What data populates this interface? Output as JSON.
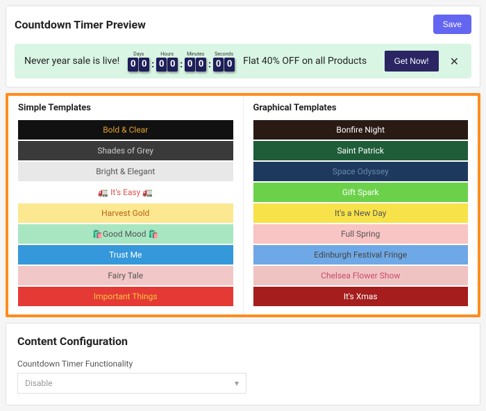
{
  "preview": {
    "title": "Countdown Timer Preview",
    "save_label": "Save",
    "banner_text_left": "Never year sale is live!",
    "banner_text_right": "Flat 40% OFF on all Products",
    "timer_labels": [
      "Days",
      "Hours",
      "Minutes",
      "Seconds"
    ],
    "timer_values": [
      "00",
      "00",
      "00",
      "00"
    ],
    "get_now_label": "Get Now!",
    "close_glyph": "✕"
  },
  "templates": {
    "simple_title": "Simple Templates",
    "graphical_title": "Graphical Templates",
    "simple": [
      {
        "label": "Bold & Clear",
        "bg": "#111111",
        "fg": "#e0a030"
      },
      {
        "label": "Shades of Grey",
        "bg": "#3a3a3a",
        "fg": "#cccccc"
      },
      {
        "label": "Bright & Elegant",
        "bg": "#e8e8e8",
        "fg": "#555555"
      },
      {
        "label": "🚛 It's Easy 🚛",
        "bg": "#ffffff",
        "fg": "#d9534f"
      },
      {
        "label": "Harvest Gold",
        "bg": "#fce890",
        "fg": "#b8621b"
      },
      {
        "label": "🛍️Good Mood 🛍️",
        "bg": "#a8e6c2",
        "fg": "#555555"
      },
      {
        "label": "Trust Me",
        "bg": "#3498db",
        "fg": "#ffffff"
      },
      {
        "label": "Fairy Tale",
        "bg": "#f2c7c7",
        "fg": "#555555"
      },
      {
        "label": "Important Things",
        "bg": "#e53935",
        "fg": "#f5c542"
      }
    ],
    "graphical": [
      {
        "label": "Bonfire Night",
        "bg": "#2a1a14",
        "fg": "#ffffff"
      },
      {
        "label": "Saint Patrick",
        "bg": "#1e5d38",
        "fg": "#ffffff"
      },
      {
        "label": "Space Odyssey",
        "bg": "#1d3a5e",
        "fg": "#6a88a8"
      },
      {
        "label": "Gift Spark",
        "bg": "#6cd14a",
        "fg": "#ffffff"
      },
      {
        "label": "It's a New Day",
        "bg": "#f7e24a",
        "fg": "#555555"
      },
      {
        "label": "Full Spring",
        "bg": "#f8c4c4",
        "fg": "#555555"
      },
      {
        "label": "Edinburgh Festival Fringe",
        "bg": "#6fa8e6",
        "fg": "#444444"
      },
      {
        "label": "Chelsea Flower Show",
        "bg": "#f0c3c3",
        "fg": "#c94b6a"
      },
      {
        "label": "It's Xmas",
        "bg": "#a51d1d",
        "fg": "#ffffff"
      }
    ]
  },
  "content": {
    "title": "Content Configuration",
    "functionality_label": "Countdown Timer Functionality",
    "functionality_value": "Disable"
  }
}
